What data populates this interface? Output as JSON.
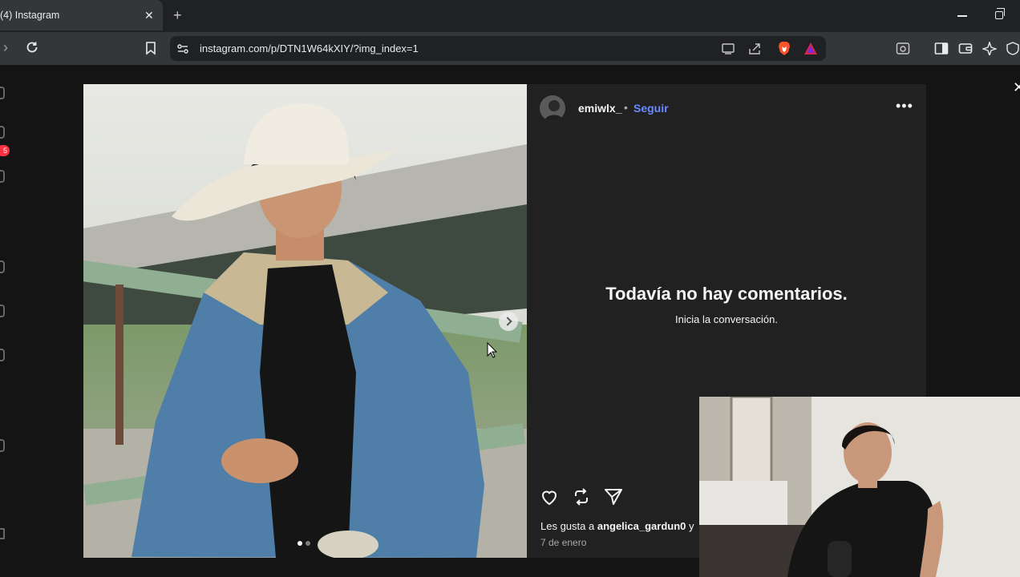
{
  "browser": {
    "tab_title": "(4) Instagram",
    "tab_close": "✕",
    "new_tab": "+",
    "url": "instagram.com/p/DTN1W64kXIY/?img_index=1"
  },
  "sidebar": {
    "badge_count": "5"
  },
  "modal": {
    "close": "✕",
    "photo_alt": "Post photo",
    "carousel_index": 1,
    "carousel_total": 2
  },
  "post": {
    "username": "emiwlx_",
    "separator": "•",
    "follow_label": "Seguir",
    "more_label": "•••",
    "empty_title": "Todavía no hay comentarios.",
    "empty_subtitle": "Inicia la conversación.",
    "likes_prefix": "Les gusta a",
    "likes_user": "angelica_gardun0",
    "likes_suffix": "y",
    "date": "7 de enero"
  },
  "colors": {
    "follow": "#6b8aff",
    "panel_bg": "#212121",
    "page_bg": "#141414"
  }
}
